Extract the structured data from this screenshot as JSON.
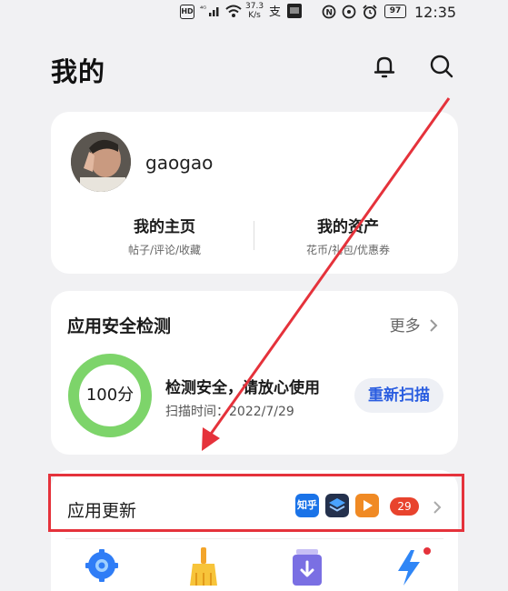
{
  "status_bar": {
    "hd": "HD",
    "signal": "⁴ᴳ",
    "speed_value": "37.3",
    "speed_unit": "K/s",
    "battery": "97",
    "time": "12:35"
  },
  "header": {
    "title": "我的",
    "bell_icon": "bell-icon",
    "search_icon": "search-icon"
  },
  "profile": {
    "username": "gaogao",
    "homepage_title": "我的主页",
    "homepage_sub": "帖子/评论/收藏",
    "assets_title": "我的资产",
    "assets_sub": "花币/礼包/优惠券"
  },
  "security": {
    "title": "应用安全检测",
    "more": "更多",
    "score": 100,
    "score_label": "100分",
    "status": "检测安全，请放心使用",
    "scan_time": "扫描时间：2022/7/29",
    "rescan": "重新扫描"
  },
  "updates": {
    "title": "应用更新",
    "apps": [
      "知乎",
      "stack-app-icon",
      "video-app-icon"
    ],
    "count": "29"
  },
  "colors": {
    "ring_green": "#7dd46a",
    "accent_blue": "#2a5de0",
    "badge_red": "#e8432d",
    "annotation_red": "#e5323b"
  }
}
